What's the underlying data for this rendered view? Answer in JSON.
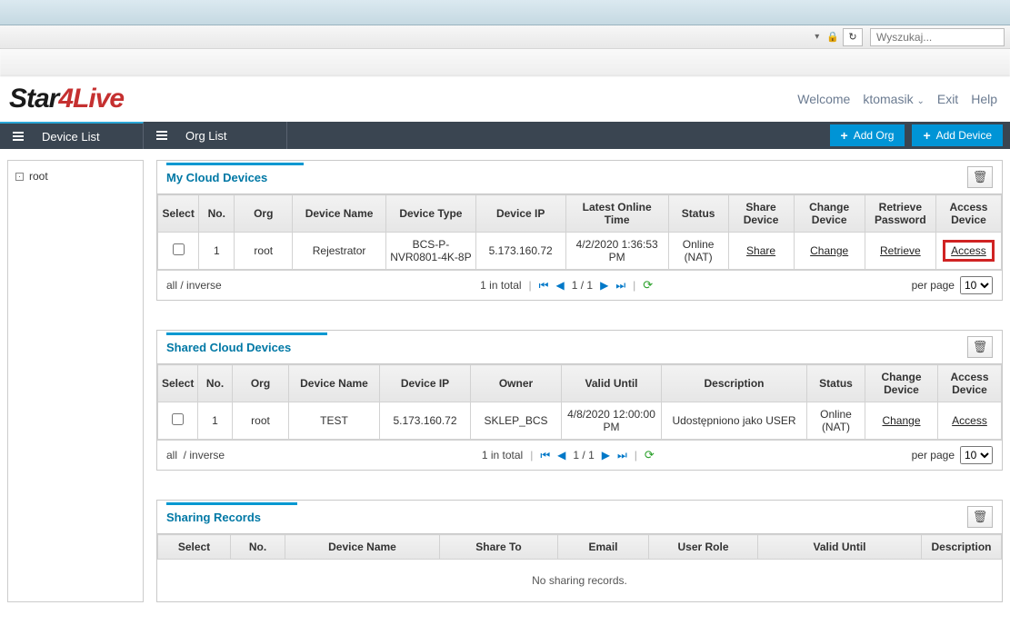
{
  "browser": {
    "search_placeholder": "Wyszukaj..."
  },
  "logo": {
    "star": "Star",
    "four": "4",
    "live": "Live"
  },
  "header": {
    "welcome": "Welcome",
    "user": "ktomasik",
    "exit": "Exit",
    "help": "Help"
  },
  "nav": {
    "device_list": "Device List",
    "org_list": "Org List",
    "add_org": "Add Org",
    "add_device": "Add Device"
  },
  "sidebar": {
    "root": "root"
  },
  "panels": {
    "my": {
      "title": "My Cloud Devices",
      "cols": [
        "Select",
        "No.",
        "Org",
        "Device Name",
        "Device Type",
        "Device IP",
        "Latest Online Time",
        "Status",
        "Share Device",
        "Change Device",
        "Retrieve Password",
        "Access Device"
      ],
      "row": {
        "no": "1",
        "org": "root",
        "name": "Rejestrator",
        "type": "BCS-P-NVR0801-4K-8P",
        "ip": "5.173.160.72",
        "time": "4/2/2020 1:36:53 PM",
        "status": "Online (NAT)",
        "share": "Share",
        "change": "Change",
        "retrieve": "Retrieve",
        "access": "Access"
      },
      "pager": {
        "all": "all",
        "inverse": "inverse",
        "total": "1 in total",
        "page": "1 / 1",
        "per_page_label": "per page",
        "per_page": "10"
      }
    },
    "shared": {
      "title": "Shared Cloud Devices",
      "cols": [
        "Select",
        "No.",
        "Org",
        "Device Name",
        "Device IP",
        "Owner",
        "Valid Until",
        "Description",
        "Status",
        "Change Device",
        "Access Device"
      ],
      "row": {
        "no": "1",
        "org": "root",
        "name": "TEST",
        "ip": "5.173.160.72",
        "owner": "SKLEP_BCS",
        "valid": "4/8/2020 12:00:00 PM",
        "desc": "Udostępniono jako USER",
        "status": "Online (NAT)",
        "change": "Change",
        "access": "Access"
      },
      "pager": {
        "all": "all",
        "inverse": "inverse",
        "total": "1 in total",
        "page": "1 / 1",
        "per_page_label": "per page",
        "per_page": "10"
      }
    },
    "records": {
      "title": "Sharing Records",
      "cols": [
        "Select",
        "No.",
        "Device Name",
        "Share To",
        "Email",
        "User Role",
        "Valid Until",
        "Description"
      ],
      "empty": "No sharing records."
    }
  }
}
